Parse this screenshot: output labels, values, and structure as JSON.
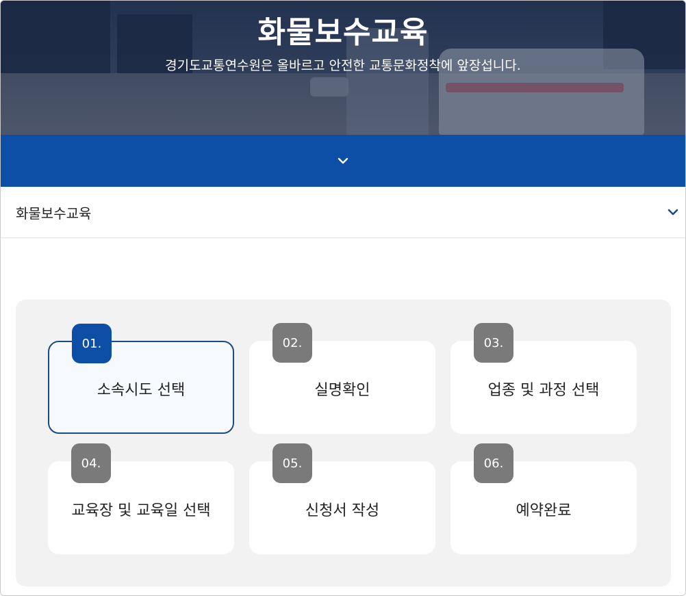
{
  "hero": {
    "title": "화물보수교육",
    "subtitle": "경기도교통연수원은 올바르고 안전한 교통문화정착에 앞장섭니다."
  },
  "menu_toggle": {
    "icon": "chevron-down-icon"
  },
  "course_select": {
    "label": "화물보수교육",
    "icon": "chevron-down-icon"
  },
  "steps": [
    {
      "num": "01.",
      "label": "소속시도 선택",
      "active": true
    },
    {
      "num": "02.",
      "label": "실명확인",
      "active": false
    },
    {
      "num": "03.",
      "label": "업종 및 과정 선택",
      "active": false
    },
    {
      "num": "04.",
      "label": "교육장 및 교육일 선택",
      "active": false
    },
    {
      "num": "05.",
      "label": "신청서 작성",
      "active": false
    },
    {
      "num": "06.",
      "label": "예약완료",
      "active": false
    }
  ],
  "colors": {
    "primary_blue": "#0d4ea6",
    "active_border": "#1b4b80",
    "inactive_badge": "#7a7a7a",
    "panel_bg": "#f2f2f2"
  }
}
